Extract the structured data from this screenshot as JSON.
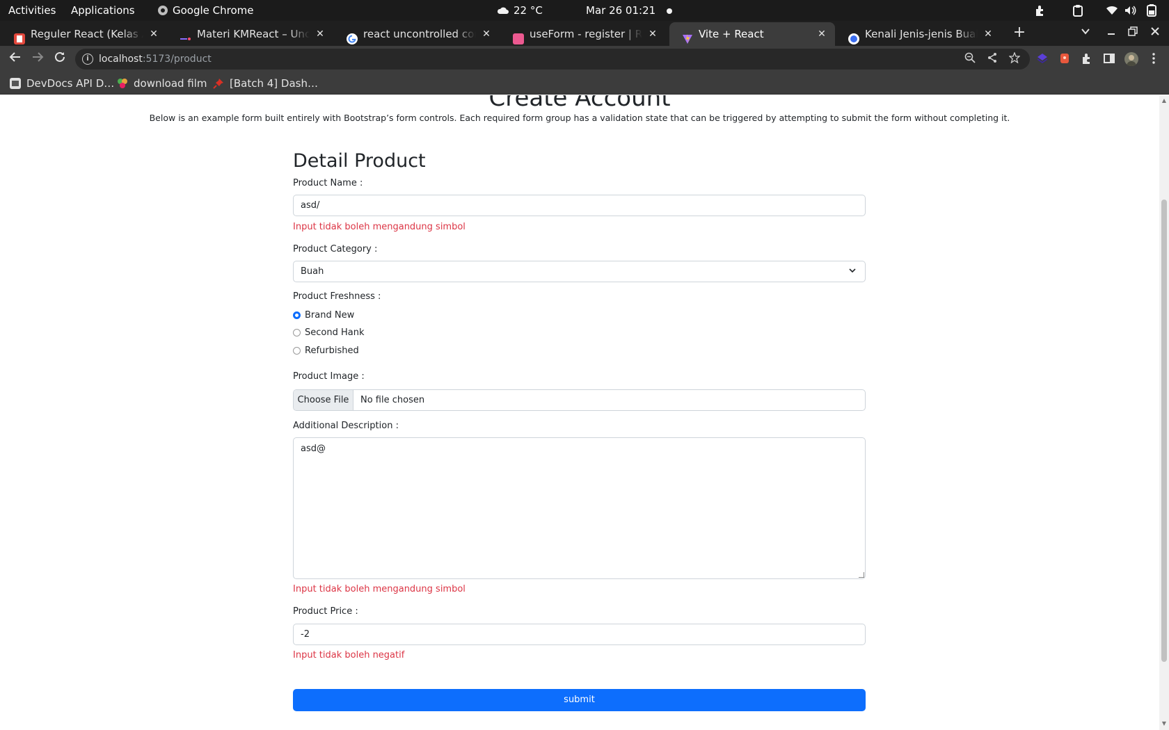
{
  "system": {
    "activities": "Activities",
    "applications": "Applications",
    "app_name": "Google Chrome",
    "weather": "22 °C",
    "datetime": "Mar 26  01:21"
  },
  "browser": {
    "tabs": [
      {
        "title": "Reguler React (Kelas A, B, C",
        "favicon_color": "#e2483d"
      },
      {
        "title": "Materi KMReact – Uncontrolled",
        "favicon_color": "#8b6cff"
      },
      {
        "title": "react uncontrolled component",
        "favicon_color": "#ffffff"
      },
      {
        "title": "useForm - register | React Hook",
        "favicon_color": "#ec5990"
      },
      {
        "title": "Vite + React",
        "favicon_color": "#a970ff"
      },
      {
        "title": "Kenali Jenis-jenis Buah Apel",
        "favicon_color": "#3a6df0"
      }
    ],
    "url_host": "localhost",
    "url_path": ":5173/product",
    "bookmarks": [
      {
        "label": "DevDocs API D…",
        "icon_color": "#555555"
      },
      {
        "label": "download film",
        "icon_color": "#e6a23c"
      },
      {
        "label": "[Batch 4] Dash…",
        "icon_color": "#d93025"
      }
    ]
  },
  "page": {
    "heading": "Create Account",
    "lead": "Below is an example form built entirely with Bootstrap’s form controls. Each required form group has a validation state that can be triggered by attempting to submit the form without completing it.",
    "form_title": "Detail Product",
    "product_name_label": "Product Name :",
    "product_name_value": "asd/",
    "product_name_error": "Input tidak boleh mengandung simbol",
    "category_label": "Product Category :",
    "category_value": "Buah",
    "freshness_label": "Product Freshness :",
    "freshness_options": [
      "Brand New",
      "Second Hank",
      "Refurbished"
    ],
    "freshness_selected": "Brand New",
    "image_label": "Product Image :",
    "image_button": "Choose File",
    "image_status": "No file chosen",
    "description_label": "Additional Description :",
    "description_value": "asd@",
    "description_error": "Input tidak boleh mengandung simbol",
    "price_label": "Product Price :",
    "price_value": "-2",
    "price_error": "Input tidak boleh negatif",
    "submit_label": "submit"
  },
  "colors": {
    "primary": "#0d6efd",
    "danger": "#dc3545"
  }
}
